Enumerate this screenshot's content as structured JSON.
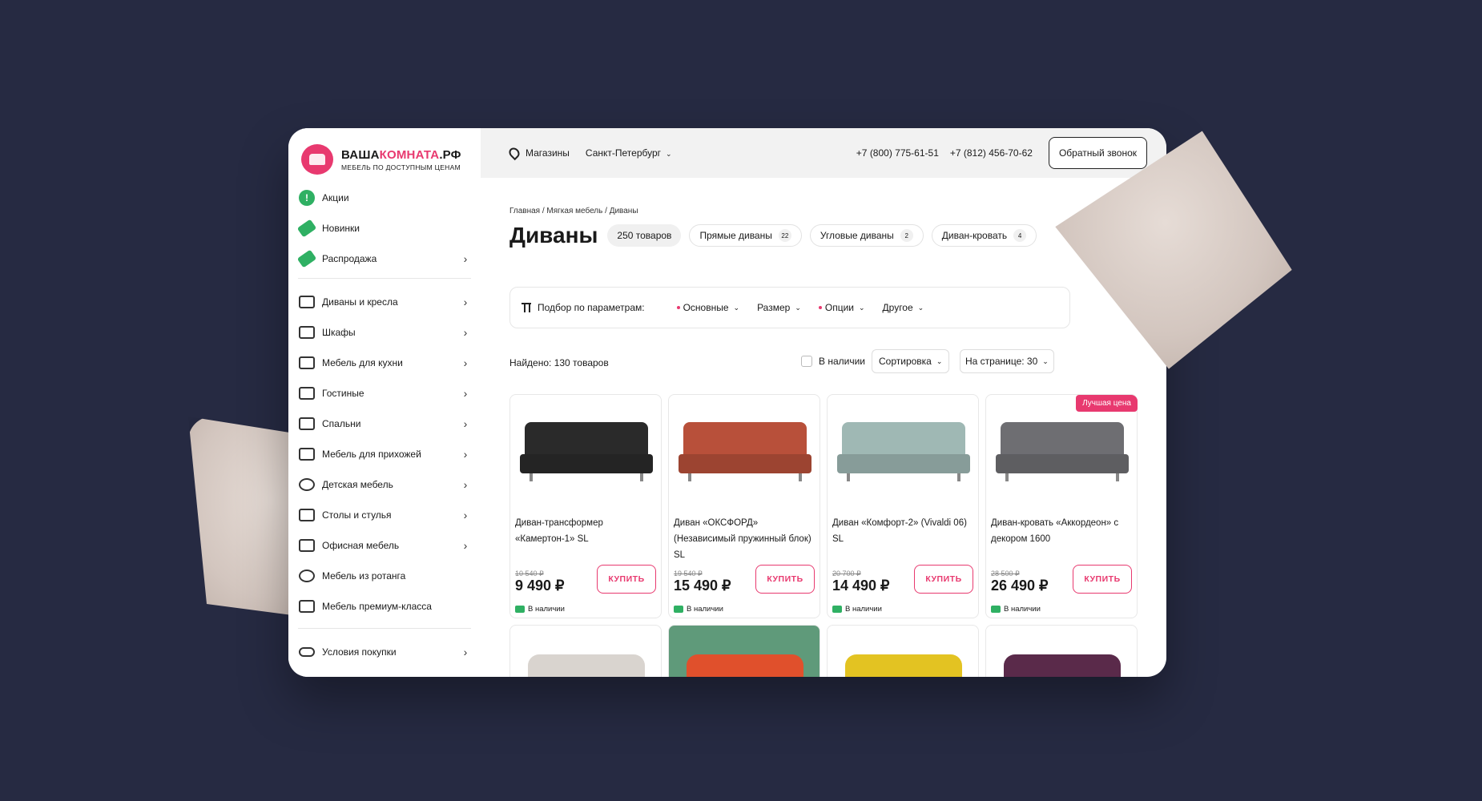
{
  "brand": {
    "name_part1": "ВАША",
    "name_part2": "КОМНАТА",
    "name_part3": ".РФ",
    "tagline": "МЕБЕЛЬ ПО ДОСТУПНЫМ ЦЕНАМ",
    "accent": "#e8396f"
  },
  "header": {
    "stores_label": "Магазины",
    "city": "Санкт-Петербург",
    "phone1": "+7 (800) 775-61-51",
    "phone2": "+7 (812) 456-70-62",
    "callback_label": "Обратный звонок"
  },
  "sidebar": {
    "promo_items": [
      {
        "label": "Акции",
        "icon": "exclamation-badge-icon"
      },
      {
        "label": "Новинки",
        "icon": "new-tag-icon"
      },
      {
        "label": "Распродажа",
        "icon": "percent-tag-icon"
      }
    ],
    "categories": [
      {
        "label": "Диваны и кресла",
        "icon": "sofa-icon"
      },
      {
        "label": "Шкафы",
        "icon": "wardrobe-icon"
      },
      {
        "label": "Мебель для кухни",
        "icon": "kitchen-icon"
      },
      {
        "label": "Гостиные",
        "icon": "living-room-icon"
      },
      {
        "label": "Спальни",
        "icon": "bed-icon"
      },
      {
        "label": "Мебель для прихожей",
        "icon": "hallway-icon"
      },
      {
        "label": "Детская мебель",
        "icon": "kids-icon"
      },
      {
        "label": "Столы и стулья",
        "icon": "table-icon"
      },
      {
        "label": "Офисная мебель",
        "icon": "office-chair-icon"
      },
      {
        "label": "Мебель из ротанга",
        "icon": "rattan-icon"
      },
      {
        "label": "Мебель премиум-класса",
        "icon": "crown-icon"
      }
    ],
    "bottom_item": {
      "label": "Условия покупки",
      "icon": "conditions-icon"
    }
  },
  "main": {
    "breadcrumb": "Главная / Мягкая мебель / Диваны",
    "title": "Диваны",
    "total_pill": "250 товаров",
    "subcategories": [
      {
        "label": "Прямые диваны",
        "count": "22"
      },
      {
        "label": "Угловые диваны",
        "count": "2"
      },
      {
        "label": "Диван-кровать",
        "count": "4"
      }
    ],
    "filter": {
      "label": "Подбор по параметрам:",
      "options": [
        "Основные",
        "Размер",
        "Опции",
        "Другое"
      ]
    },
    "found": "Найдено: 130 товаров",
    "in_stock_label": "В наличии",
    "sort_label": "Сортировка",
    "per_page_label": "На странице: 30",
    "products": [
      {
        "name": "Диван-трансформер «Камертон-1» SL",
        "old_price": "10 540 ₽",
        "price": "9 490 ₽",
        "buy": "КУПИТЬ",
        "availability": "В наличии",
        "color": "#2a2a2a",
        "badge": ""
      },
      {
        "name": "Диван «ОКСФОРД» (Независимый пружинный блок) SL",
        "old_price": "19 540 ₽",
        "price": "15 490 ₽",
        "buy": "КУПИТЬ",
        "availability": "В наличии",
        "color": "#b8503a",
        "badge": ""
      },
      {
        "name": "Диван «Комфорт-2» (Vivaldi 06) SL",
        "old_price": "20 700 ₽",
        "price": "14 490 ₽",
        "buy": "КУПИТЬ",
        "availability": "В наличии",
        "color": "#9fb8b4",
        "badge": ""
      },
      {
        "name": "Диван-кровать «Аккордеон» с декором 1600",
        "old_price": "28 500 ₽",
        "price": "26 490 ₽",
        "buy": "КУПИТЬ",
        "availability": "В наличии",
        "color": "#6e6e72",
        "badge": "Лучшая цена"
      }
    ],
    "more_products_colors": [
      "#d9d4cf",
      "#e0502c",
      "#e3c322",
      "#5a2a4a"
    ]
  }
}
